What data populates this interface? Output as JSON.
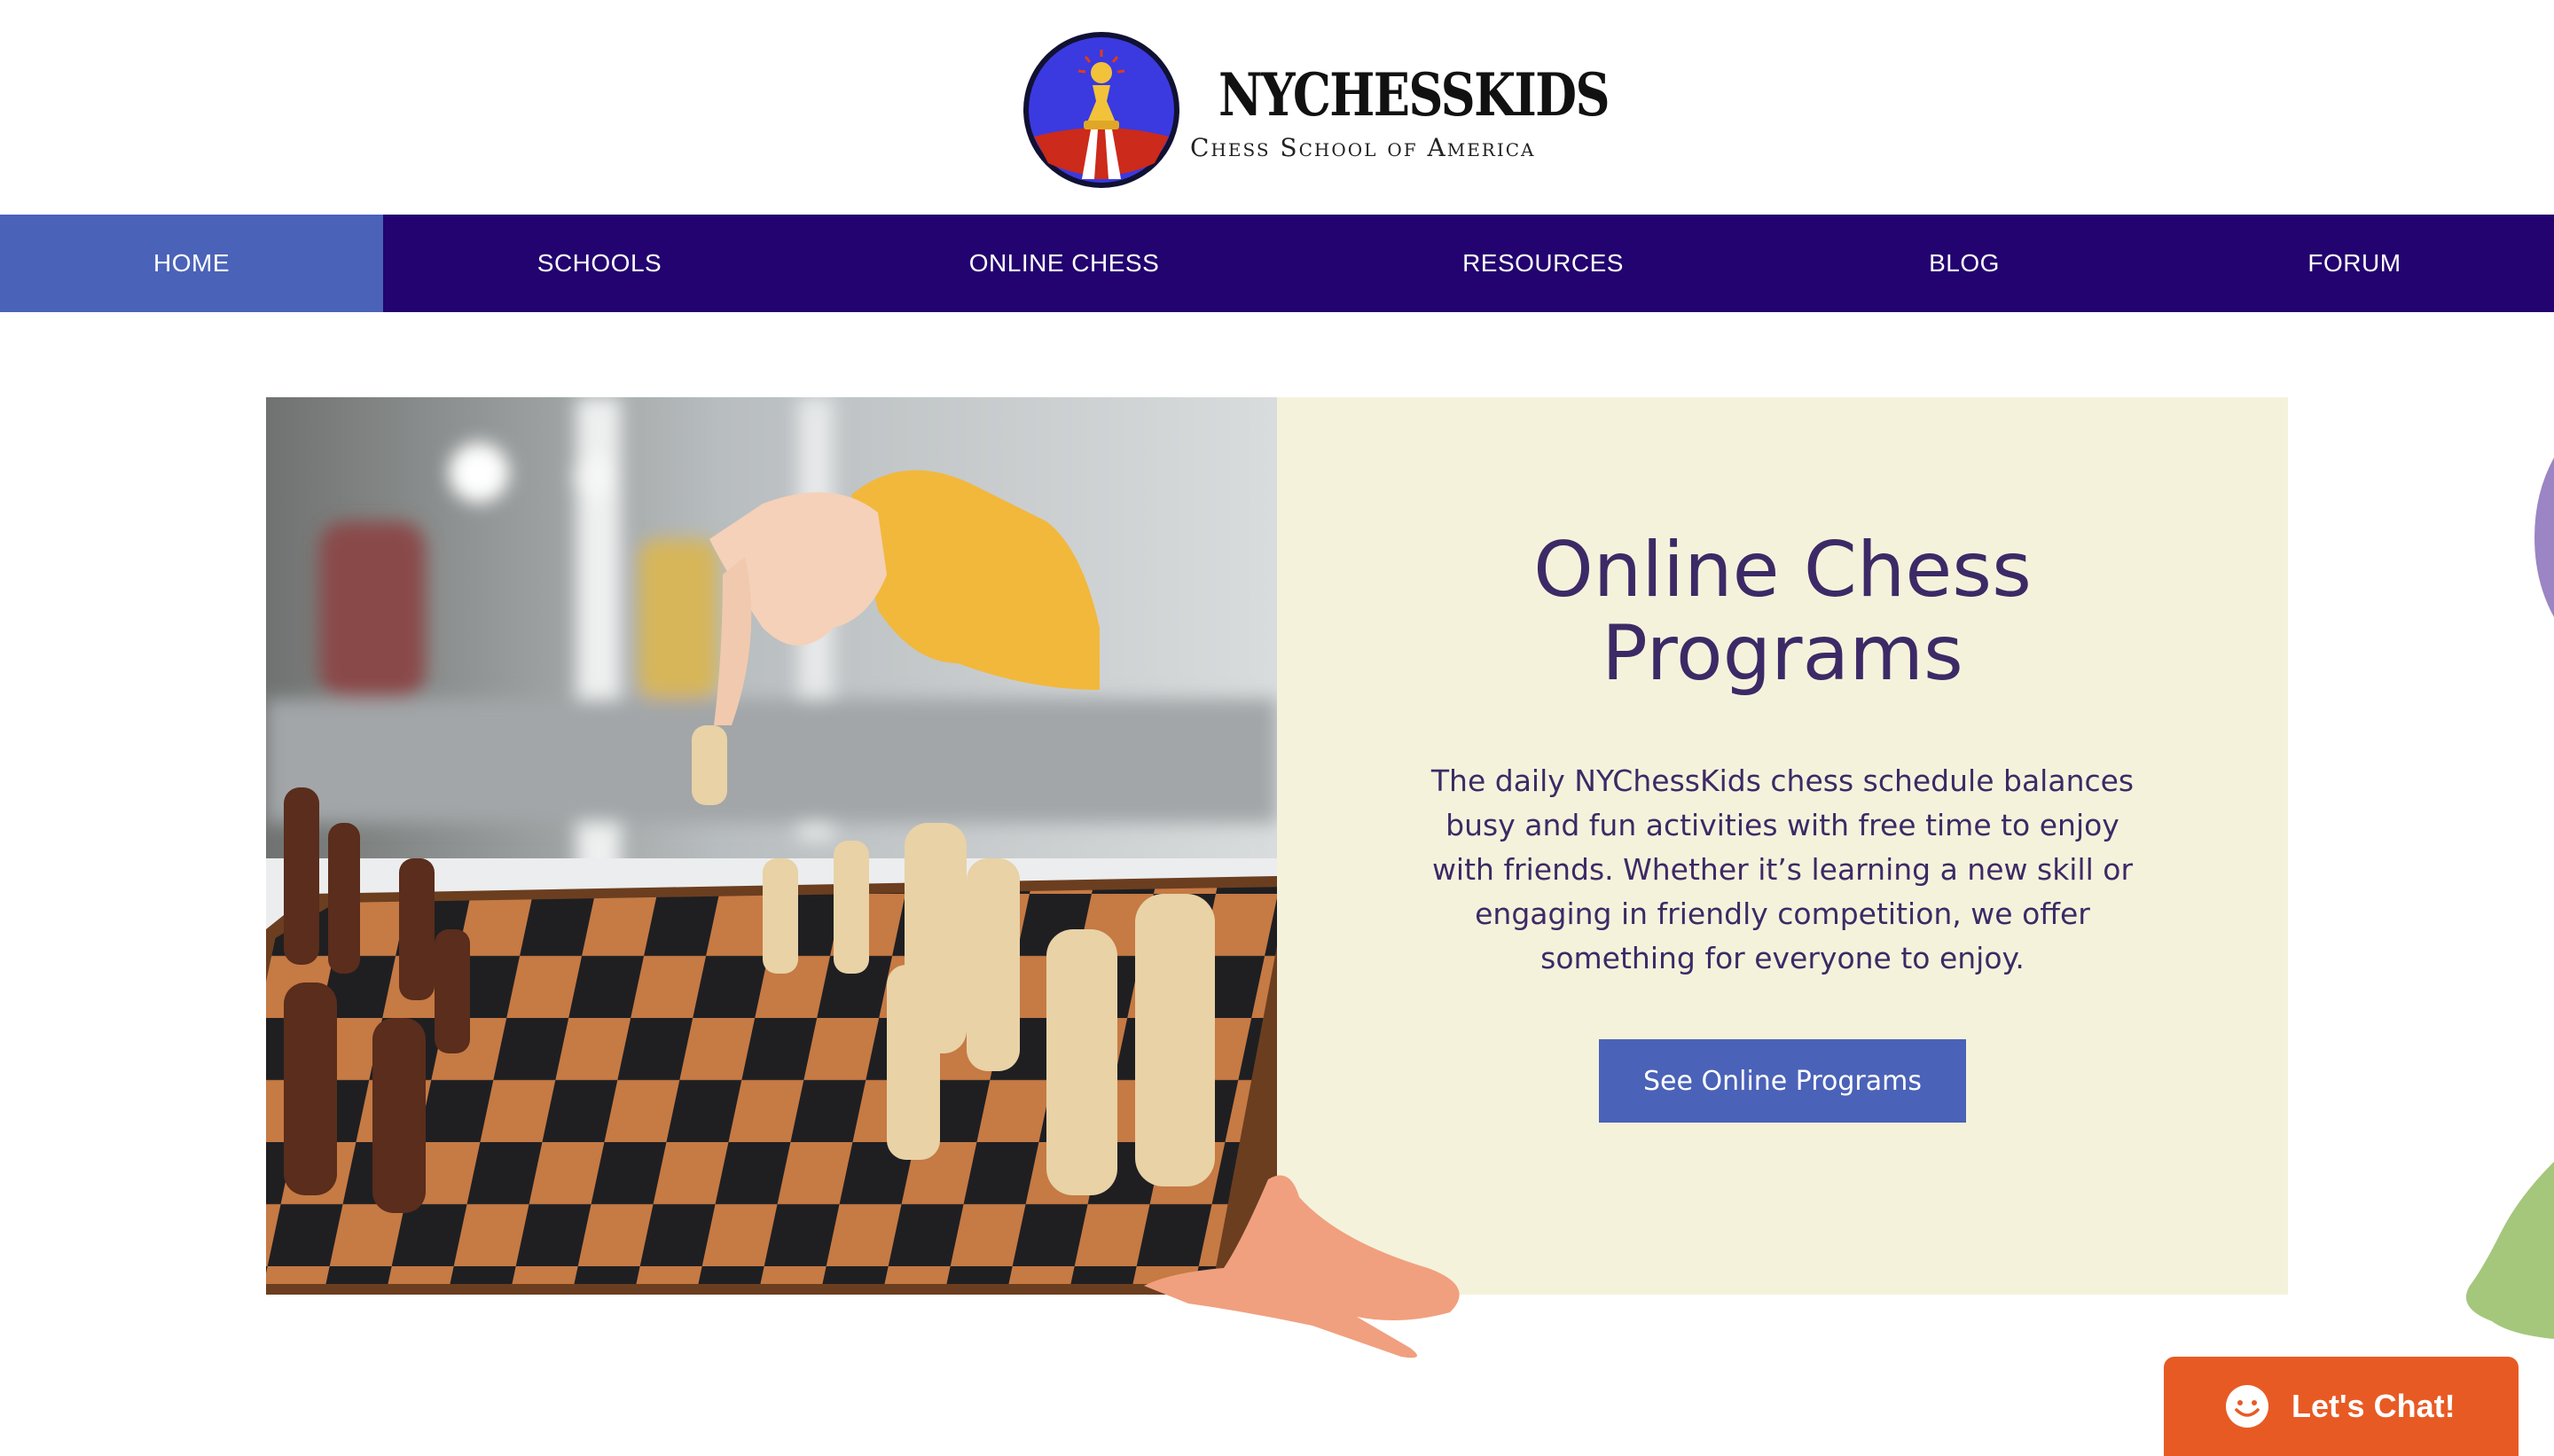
{
  "brand": {
    "name": "NYCHESSKIDS",
    "tagline": "Chess School of America"
  },
  "nav": {
    "items": [
      {
        "label": "HOME",
        "active": true
      },
      {
        "label": "SCHOOLS",
        "active": false
      },
      {
        "label": "ONLINE CHESS",
        "active": false
      },
      {
        "label": "RESOURCES",
        "active": false
      },
      {
        "label": "BLOG",
        "active": false
      },
      {
        "label": "FORUM",
        "active": false
      }
    ]
  },
  "hero": {
    "title_line1": "Online Chess",
    "title_line2": "Programs",
    "body": "The daily NYChessKids chess schedule balances busy and fun activities with free time to enjoy with friends. Whether it’s learning a new skill or engaging in friendly competition, we offer something for everyone to enjoy.",
    "button_label": "See Online Programs"
  },
  "chat": {
    "label": "Let's Chat!"
  },
  "colors": {
    "nav_background": "#22036f",
    "nav_active": "#4a62b8",
    "panel_background": "#f5f2dc",
    "heading_text": "#3c2a66",
    "button": "#4a62b8",
    "chat_button": "#e85a24",
    "accent_orange": "#f0a07e",
    "accent_green": "#a4c77c",
    "accent_purple": "#9b85c4"
  },
  "icons": {
    "logo": "pawn-emblem-icon",
    "chat": "smiley-chat-icon"
  }
}
